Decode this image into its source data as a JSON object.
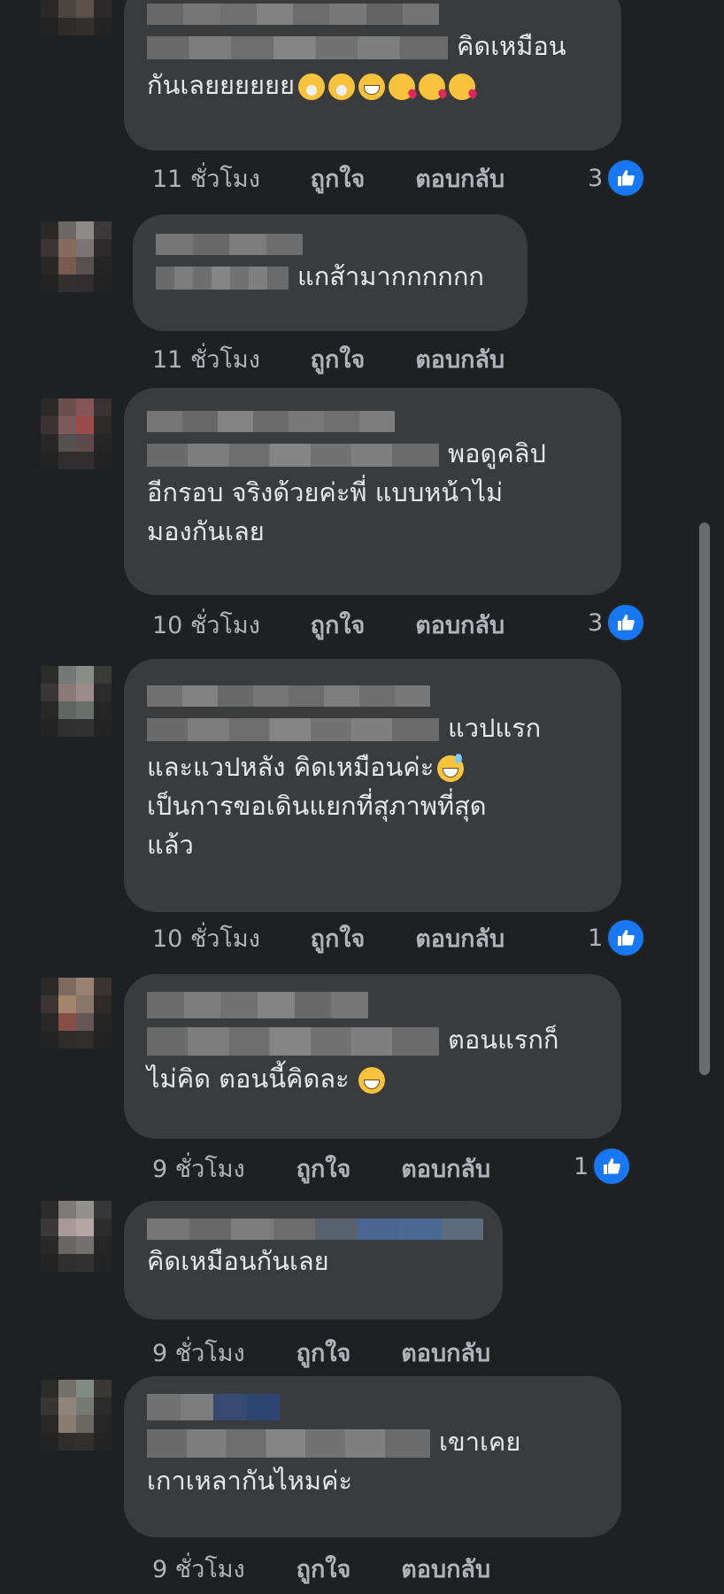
{
  "comments": [
    {
      "lines": [
        "คิดเหมือน",
        "กันเลยยยยยย"
      ],
      "emojis": [
        "yawn",
        "yawn",
        "grin",
        "kiss",
        "kiss",
        "kiss"
      ],
      "time": "11 ชั่วโมง",
      "like_label": "ถูกใจ",
      "reply_label": "ตอบกลับ",
      "reactions": "3"
    },
    {
      "lines": [
        "แกส้ามากกกกกก"
      ],
      "time": "11 ชั่วโมง",
      "like_label": "ถูกใจ",
      "reply_label": "ตอบกลับ"
    },
    {
      "lines": [
        "พอดูคลิป",
        "อีกรอบ จริงด้วยค่ะพี่ แบบหน้าไม่",
        "มองกันเลย"
      ],
      "time": "10 ชั่วโมง",
      "like_label": "ถูกใจ",
      "reply_label": "ตอบกลับ",
      "reactions": "3"
    },
    {
      "lines": [
        "แวปแรก",
        "และแวปหลัง คิดเหมือนค่ะ",
        "เป็นการขอเดินแยกที่สุภาพที่สุด",
        "แล้ว"
      ],
      "emojis": [
        "sweat"
      ],
      "time": "10 ชั่วโมง",
      "like_label": "ถูกใจ",
      "reply_label": "ตอบกลับ",
      "reactions": "1"
    },
    {
      "lines": [
        "ตอนแรกก็",
        "ไม่คิด ตอนนี้คิดละ"
      ],
      "emojis": [
        "smile"
      ],
      "time": "9 ชั่วโมง",
      "like_label": "ถูกใจ",
      "reply_label": "ตอบกลับ",
      "reactions": "1"
    },
    {
      "lines": [
        "คิดเหมือนกันเลย"
      ],
      "time": "9 ชั่วโมง",
      "like_label": "ถูกใจ",
      "reply_label": "ตอบกลับ"
    },
    {
      "lines": [
        "เขาเคย",
        "เกาเหลากันไหมค่ะ"
      ],
      "time": "9 ชั่วโมง",
      "like_label": "ถูกใจ",
      "reply_label": "ตอบกลับ"
    }
  ],
  "colors": {
    "background": "#1f2022",
    "bubble": "#3a3b3c",
    "like_blue": "#1877f2",
    "meta_text": "#b0b3b8"
  },
  "icons": {
    "reaction": "thumbs-up-icon"
  }
}
